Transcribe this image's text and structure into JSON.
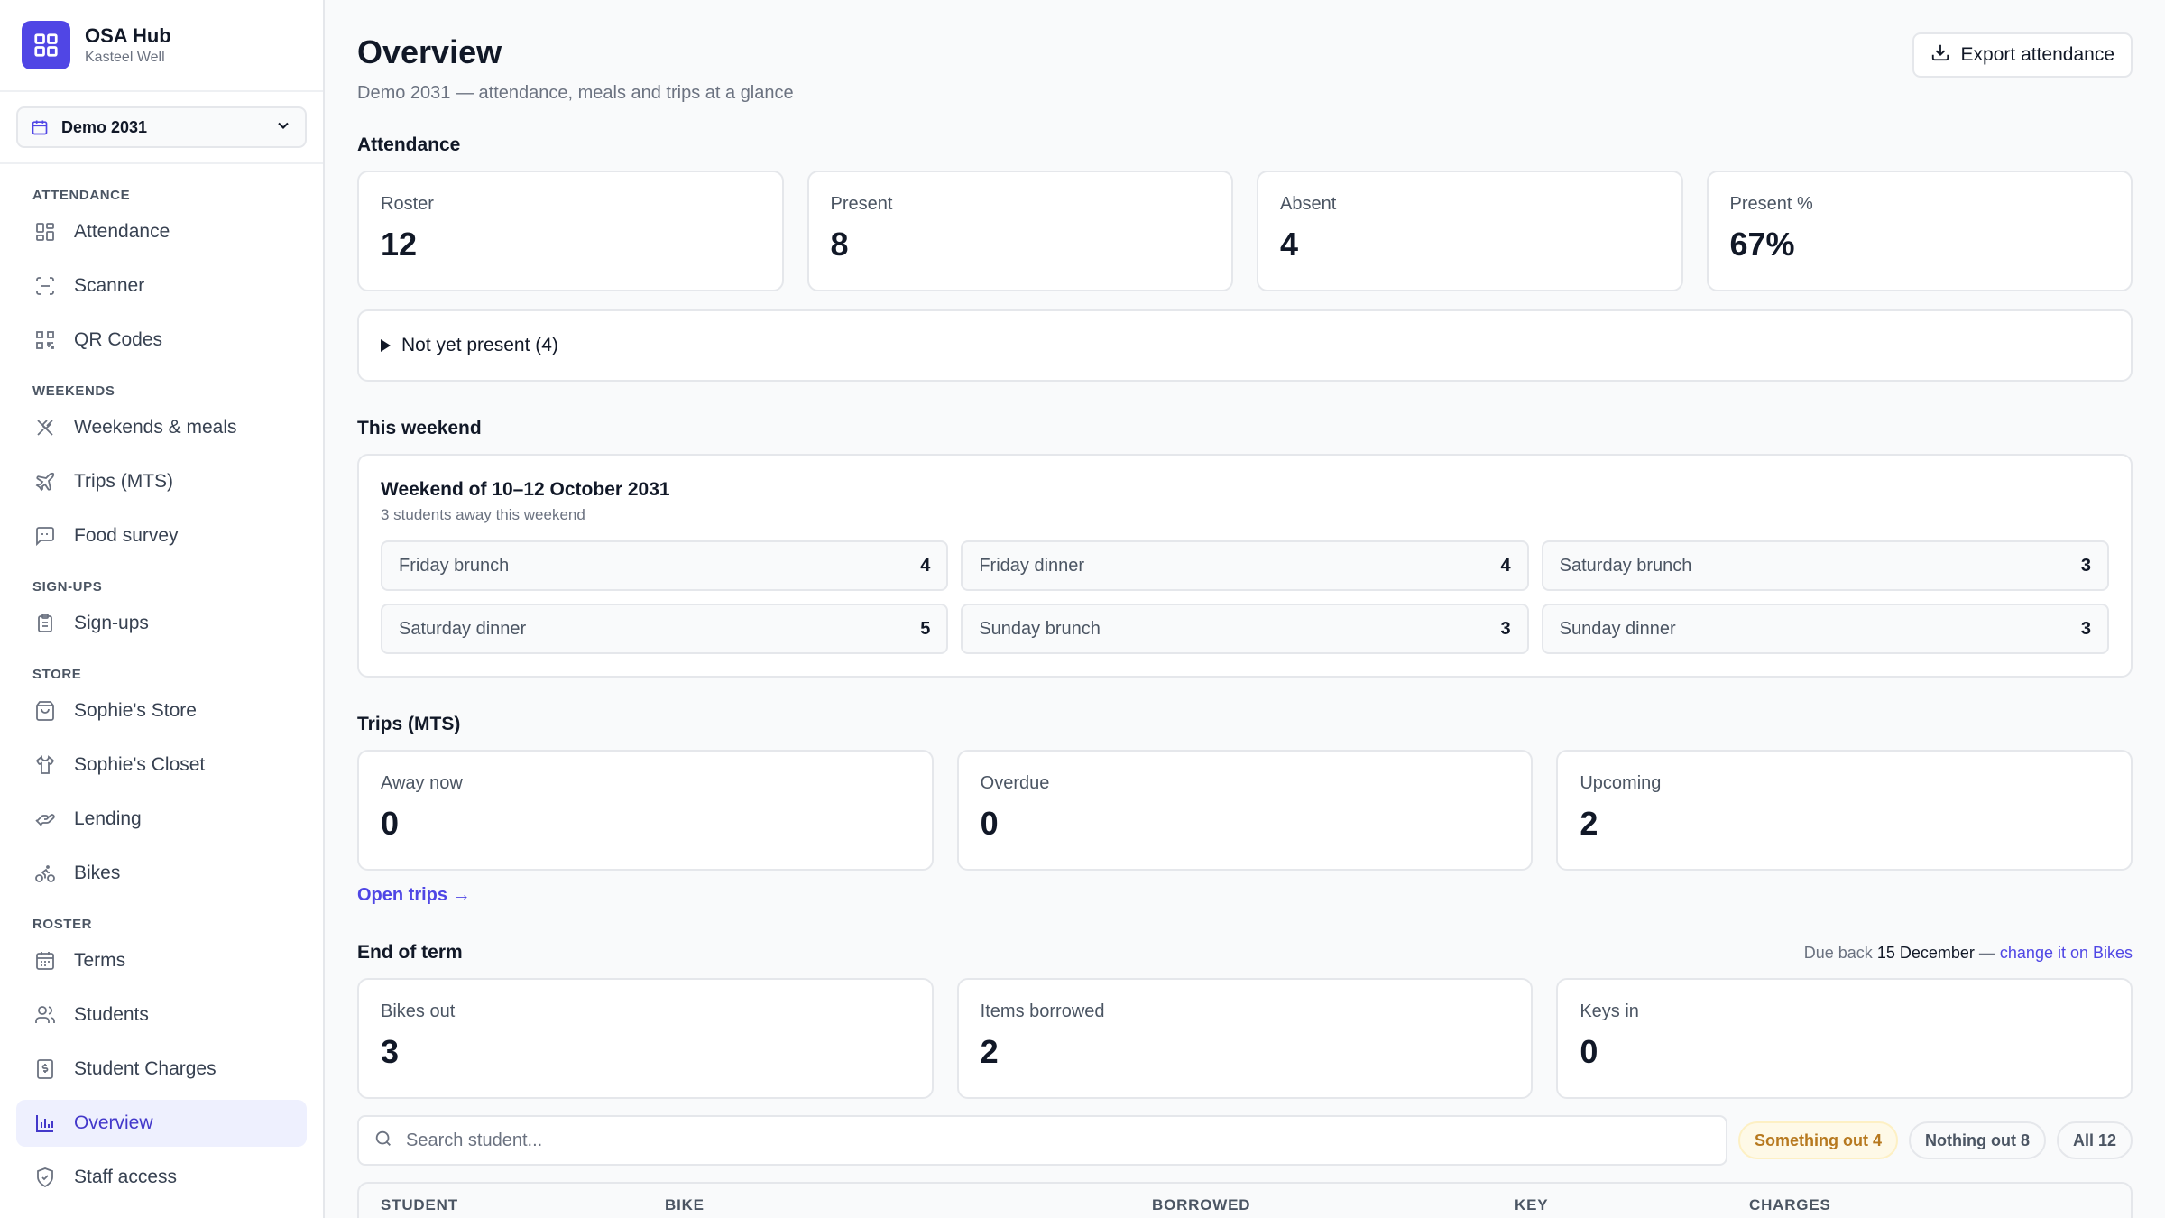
{
  "brand": {
    "title": "OSA Hub",
    "subtitle": "Kasteel Well"
  },
  "term": {
    "selected": "Demo 2031"
  },
  "nav": {
    "groups": [
      {
        "label": "ATTENDANCE",
        "items": [
          {
            "label": "Attendance",
            "icon": "dashboard-icon"
          },
          {
            "label": "Scanner",
            "icon": "scan-icon"
          },
          {
            "label": "QR Codes",
            "icon": "qr-code-icon"
          }
        ]
      },
      {
        "label": "WEEKENDS",
        "items": [
          {
            "label": "Weekends & meals",
            "icon": "utensils-icon"
          },
          {
            "label": "Trips (MTS)",
            "icon": "plane-icon"
          },
          {
            "label": "Food survey",
            "icon": "message-icon"
          }
        ]
      },
      {
        "label": "SIGN-UPS",
        "items": [
          {
            "label": "Sign-ups",
            "icon": "clipboard-icon"
          }
        ]
      },
      {
        "label": "STORE",
        "items": [
          {
            "label": "Sophie's Store",
            "icon": "store-icon"
          },
          {
            "label": "Sophie's Closet",
            "icon": "shirt-icon"
          },
          {
            "label": "Lending",
            "icon": "hand-icon"
          },
          {
            "label": "Bikes",
            "icon": "bike-icon"
          }
        ]
      },
      {
        "label": "ROSTER",
        "items": [
          {
            "label": "Terms",
            "icon": "calendar-icon"
          },
          {
            "label": "Students",
            "icon": "users-icon"
          },
          {
            "label": "Student Charges",
            "icon": "receipt-icon"
          },
          {
            "label": "Overview",
            "icon": "chart-icon",
            "active": true
          },
          {
            "label": "Staff access",
            "icon": "shield-icon"
          }
        ]
      }
    ]
  },
  "header": {
    "title": "Overview",
    "subtitle": "Demo 2031 — attendance, meals and trips at a glance",
    "export_label": "Export attendance"
  },
  "attendance": {
    "title": "Attendance",
    "stats": [
      {
        "label": "Roster",
        "value": "12"
      },
      {
        "label": "Present",
        "value": "8"
      },
      {
        "label": "Absent",
        "value": "4"
      },
      {
        "label": "Present %",
        "value": "67%"
      }
    ],
    "not_present": "Not yet present (4)"
  },
  "weekend": {
    "title": "This weekend",
    "card_title": "Weekend of 10–12 October 2031",
    "card_sub": "3 students away this weekend",
    "meals": [
      {
        "label": "Friday brunch",
        "count": "4"
      },
      {
        "label": "Friday dinner",
        "count": "4"
      },
      {
        "label": "Saturday brunch",
        "count": "3"
      },
      {
        "label": "Saturday dinner",
        "count": "5"
      },
      {
        "label": "Sunday brunch",
        "count": "3"
      },
      {
        "label": "Sunday dinner",
        "count": "3"
      }
    ]
  },
  "trips": {
    "title": "Trips (MTS)",
    "stats": [
      {
        "label": "Away now",
        "value": "0"
      },
      {
        "label": "Overdue",
        "value": "0"
      },
      {
        "label": "Upcoming",
        "value": "2"
      }
    ],
    "link": "Open trips →"
  },
  "end_of_term": {
    "title": "End of term",
    "due_prefix": "Due back",
    "due_date": "15 December",
    "due_sep": "—",
    "due_link": "change it on Bikes",
    "stats": [
      {
        "label": "Bikes out",
        "value": "3"
      },
      {
        "label": "Items borrowed",
        "value": "2"
      },
      {
        "label": "Keys in",
        "value": "0"
      }
    ],
    "search_placeholder": "Search student...",
    "filters": [
      {
        "label": "Something out 4"
      },
      {
        "label": "Nothing out 8"
      },
      {
        "label": "All 12"
      }
    ],
    "columns": [
      "STUDENT",
      "BIKE",
      "BORROWED",
      "KEY",
      "CHARGES"
    ]
  },
  "colors": {
    "accent": "#4f46e5",
    "warning": "#b7791f"
  }
}
